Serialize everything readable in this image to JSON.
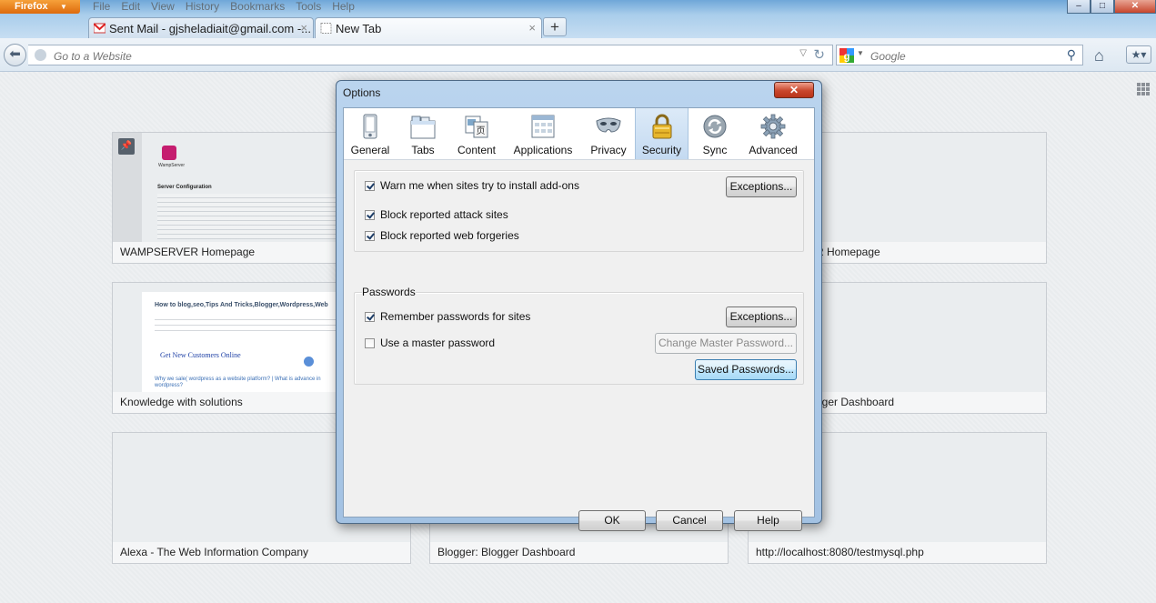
{
  "browser": {
    "app_button": "Firefox",
    "menu": [
      "File",
      "Edit",
      "View",
      "History",
      "Bookmarks",
      "Tools",
      "Help"
    ],
    "tabs": [
      {
        "label": "Sent Mail - gjsheladiait@gmail.com -...",
        "close": "×"
      },
      {
        "label": "New Tab",
        "close": "×"
      }
    ],
    "new_tab_label": "+",
    "url_placeholder": "Go to a Website",
    "search_placeholder": "Google",
    "window_controls": {
      "minimize": "–",
      "maximize": "□",
      "close": "✕"
    }
  },
  "new_tab_page": {
    "thumbnails": [
      {
        "title": "WAMPSERVER Homepage",
        "pinned": true
      },
      {
        "title": "R Homepage"
      },
      {
        "title": "Knowledge with solutions"
      },
      {
        "title": "gger Dashboard"
      },
      {
        "title": "Alexa - The Web Information Company"
      },
      {
        "title": "Blogger: Blogger Dashboard"
      },
      {
        "title": "http://localhost:8080/testmysql.php"
      }
    ],
    "wamp_preview": {
      "heading": "Server Configuration",
      "logo_text": "WampServer"
    },
    "blog_preview": {
      "heading": "How to blog,seo,Tips And Tricks,Blogger,Wordpress,Web",
      "ad_title": "Get New Customers Online",
      "link_text": "Why we sale( wordpress as a website platform? | What is advance in wordpress?"
    }
  },
  "dialog": {
    "title": "Options",
    "close_label": "✕",
    "panes": [
      {
        "label": "General",
        "icon": "general-icon"
      },
      {
        "label": "Tabs",
        "icon": "tabs-icon"
      },
      {
        "label": "Content",
        "icon": "content-icon"
      },
      {
        "label": "Applications",
        "icon": "applications-icon"
      },
      {
        "label": "Privacy",
        "icon": "privacy-mask-icon"
      },
      {
        "label": "Security",
        "icon": "padlock-icon",
        "selected": true
      },
      {
        "label": "Sync",
        "icon": "sync-icon"
      },
      {
        "label": "Advanced",
        "icon": "gear-icon"
      }
    ],
    "general_group": {
      "warn_addons": {
        "label": "Warn me when sites try to install add-ons",
        "checked": true
      },
      "exceptions_label": "Exceptions...",
      "block_attack": {
        "label": "Block reported attack sites",
        "checked": true
      },
      "block_forgeries": {
        "label": "Block reported web forgeries",
        "checked": true
      }
    },
    "passwords_group": {
      "legend": "Passwords",
      "remember": {
        "label": "Remember passwords for sites",
        "checked": true
      },
      "exceptions_label": "Exceptions...",
      "master": {
        "label": "Use a master password",
        "checked": false
      },
      "change_master_label": "Change Master Password...",
      "saved_passwords_label": "Saved Passwords..."
    },
    "footer": {
      "ok": "OK",
      "cancel": "Cancel",
      "help": "Help"
    }
  },
  "colors": {
    "accent": "#3c7fb1",
    "firefox_orange": "#e8811f",
    "dialog_frame": "#a3c2e3"
  }
}
